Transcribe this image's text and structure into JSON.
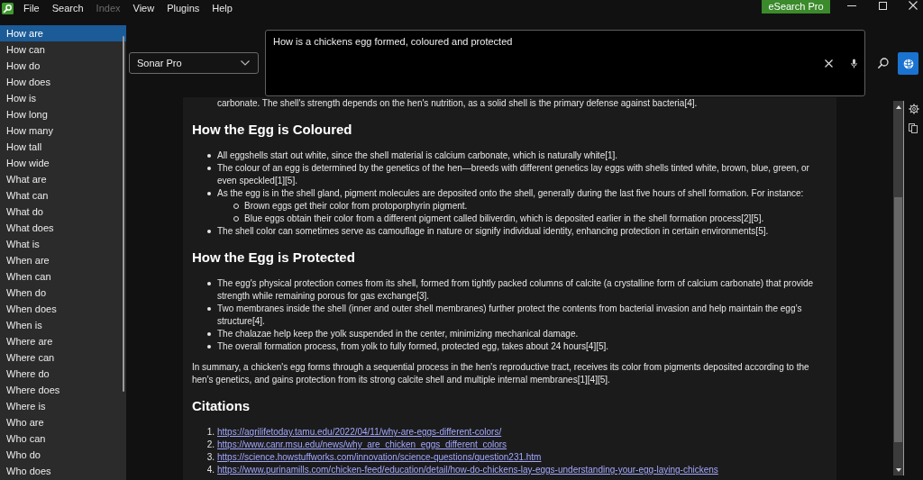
{
  "menu_bar": {
    "items": [
      {
        "label": "File",
        "disabled": false
      },
      {
        "label": "Search",
        "disabled": false
      },
      {
        "label": "Index",
        "disabled": true
      },
      {
        "label": "View",
        "disabled": false
      },
      {
        "label": "Plugins",
        "disabled": false
      },
      {
        "label": "Help",
        "disabled": false
      }
    ],
    "upgrade_button": "eSearch Pro"
  },
  "sidebar": {
    "items": [
      {
        "label": "How are",
        "selected": true
      },
      {
        "label": "How can",
        "selected": false
      },
      {
        "label": "How do",
        "selected": false
      },
      {
        "label": "How does",
        "selected": false
      },
      {
        "label": "How is",
        "selected": false
      },
      {
        "label": "How long",
        "selected": false
      },
      {
        "label": "How many",
        "selected": false
      },
      {
        "label": "How tall",
        "selected": false
      },
      {
        "label": "How wide",
        "selected": false
      },
      {
        "label": "What are",
        "selected": false
      },
      {
        "label": "What can",
        "selected": false
      },
      {
        "label": "What do",
        "selected": false
      },
      {
        "label": "What does",
        "selected": false
      },
      {
        "label": "What is",
        "selected": false
      },
      {
        "label": "When are",
        "selected": false
      },
      {
        "label": "When can",
        "selected": false
      },
      {
        "label": "When do",
        "selected": false
      },
      {
        "label": "When does",
        "selected": false
      },
      {
        "label": "When is",
        "selected": false
      },
      {
        "label": "Where are",
        "selected": false
      },
      {
        "label": "Where can",
        "selected": false
      },
      {
        "label": "Where do",
        "selected": false
      },
      {
        "label": "Where does",
        "selected": false
      },
      {
        "label": "Where is",
        "selected": false
      },
      {
        "label": "Who are",
        "selected": false
      },
      {
        "label": "Who can",
        "selected": false
      },
      {
        "label": "Who do",
        "selected": false
      },
      {
        "label": "Who does",
        "selected": false
      }
    ]
  },
  "search": {
    "model": "Sonar Pro",
    "query": "How is a chickens egg formed, coloured and protected"
  },
  "answer": {
    "blocks": [
      {
        "kind": "continuation",
        "text": "carbonate. The shell's strength depends on the hen's nutrition, as a solid shell is the primary defense against bacteria[4]."
      },
      {
        "kind": "heading",
        "text": "How the Egg is Coloured"
      },
      {
        "kind": "bullets",
        "items": [
          {
            "text": "All eggshells start out white, since the shell material is calcium carbonate, which is naturally white[1]."
          },
          {
            "text": "The colour of an egg is determined by the genetics of the hen—breeds with different genetics lay eggs with shells tinted white, brown, blue, green, or even speckled[1][5]."
          },
          {
            "text": "As the egg is in the shell gland, pigment molecules are deposited onto the shell, generally during the last five hours of shell formation. For instance:",
            "children": [
              {
                "text": "Brown eggs get their color from protoporphyrin pigment."
              },
              {
                "text": "Blue eggs obtain their color from a different pigment called biliverdin, which is deposited earlier in the shell formation process[2][5]."
              }
            ]
          },
          {
            "text": "The shell color can sometimes serve as camouflage in nature or signify individual identity, enhancing protection in certain environments[5]."
          }
        ]
      },
      {
        "kind": "heading",
        "text": "How the Egg is Protected"
      },
      {
        "kind": "bullets",
        "items": [
          {
            "text": "The egg's physical protection comes from its shell, formed from tightly packed columns of calcite (a crystalline form of calcium carbonate) that provide strength while remaining porous for gas exchange[3]."
          },
          {
            "text": "Two membranes inside the shell (inner and outer shell membranes) further protect the contents from bacterial invasion and help maintain the egg’s structure[4]."
          },
          {
            "text": "The chalazae help keep the yolk suspended in the center, minimizing mechanical damage."
          },
          {
            "text": "The overall formation process, from yolk to fully formed, protected egg, takes about 24 hours[4][5]."
          }
        ]
      },
      {
        "kind": "paragraph",
        "text": "In summary, a chicken's egg forms through a sequential process in the hen's reproductive tract, receives its color from pigments deposited according to the hen's genetics, and gains protection from its strong calcite shell and multiple internal membranes[1][4][5]."
      },
      {
        "kind": "heading",
        "text": "Citations"
      },
      {
        "kind": "numbered_links",
        "items": [
          {
            "number": "1.",
            "url": "https://agrilifetoday.tamu.edu/2022/04/11/why-are-eggs-different-colors/"
          },
          {
            "number": "2.",
            "url": "https://www.canr.msu.edu/news/why_are_chicken_eggs_different_colors"
          },
          {
            "number": "3.",
            "url": "https://science.howstuffworks.com/innovation/science-questions/question231.htm"
          },
          {
            "number": "4.",
            "url": "https://www.purinamills.com/chicken-feed/education/detail/how-do-chickens-lay-eggs-understanding-your-egg-laying-chickens"
          }
        ]
      }
    ]
  }
}
